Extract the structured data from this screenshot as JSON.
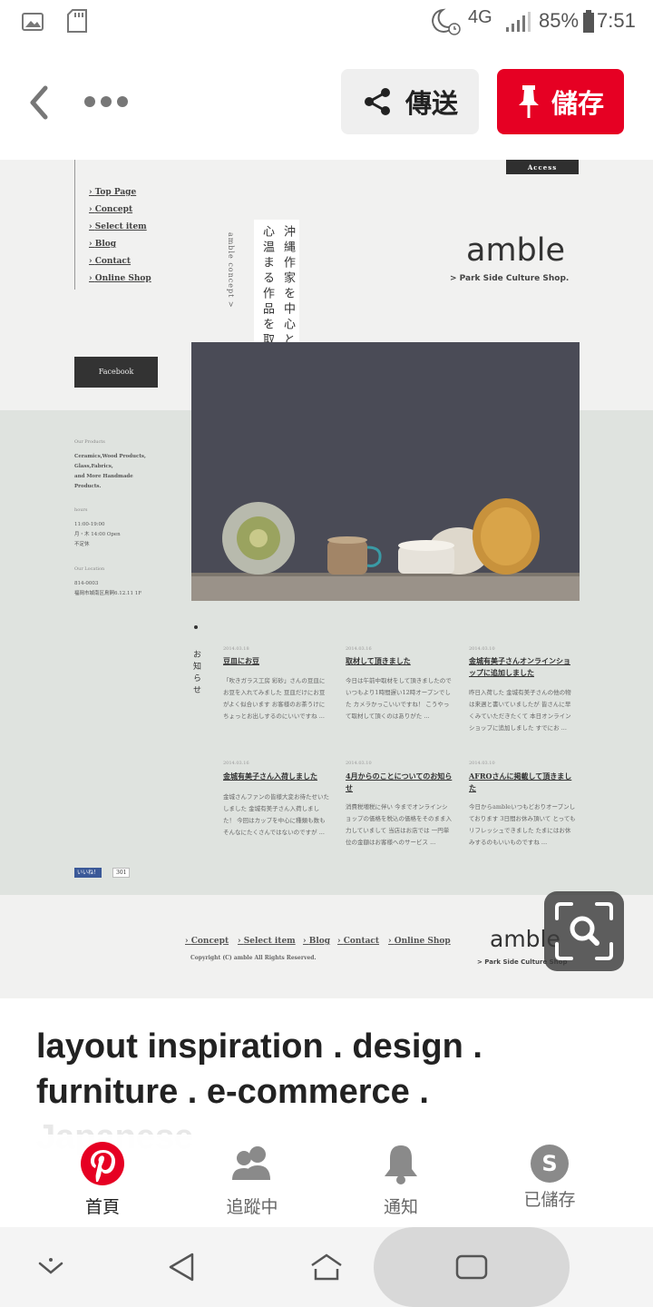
{
  "status_bar": {
    "network": "4G",
    "battery": "85%",
    "time": "7:51"
  },
  "top_bar": {
    "share_label": "傳送",
    "save_label": "儲存"
  },
  "pin_image": {
    "nav_items": [
      "Top Page",
      "Concept",
      "Select item",
      "Blog",
      "Contact",
      "Online Shop"
    ],
    "access_label": "Access",
    "concept_vertical": "amble concept >",
    "tagline_col1": "沖縄作家を中心とした",
    "tagline_col2": "心温まる作品を取扱います",
    "brand": "amble",
    "brand_sub": "> Park Side Culture Shop.",
    "facebook_label": "Facebook",
    "products_heading": "Our Products",
    "products_text": [
      "Ceramics,Wood Products,",
      "Glass,Fabrics,",
      "and More Handmade",
      "Products."
    ],
    "hours_heading": "hours",
    "hours_text": [
      "11:00-19:00",
      "月・木 14:00 Open",
      "不定休"
    ],
    "location_heading": "Our Location",
    "location_text": [
      "814-0003",
      "福岡市城南区鳥飼6.12.11 1F"
    ],
    "news_heading": "お知らせ",
    "news": [
      {
        "date": "2014.03.18",
        "title": "豆皿にお豆",
        "body": "「吹きガラス工房 彩砂」さんの豆皿にお豆を入れてみました 豆皿だけにお豆がよく似合います お客様のお茶うけにちょっとお出しするのにいいですね ..."
      },
      {
        "date": "2014.03.16",
        "title": "取材して頂きました",
        "body": "今日は午前中取材をして頂きましたので いつもより1時間遅い12時オープンでした カメラかっこいいですね！ こうやって取材して頂くのはありがた ..."
      },
      {
        "date": "2014.03.10",
        "title": "金城有美子さんオンラインショップに追加しました",
        "body": "昨日入荷した 金城有美子さんの他の物は来週と書いていましたが 皆さんに早くみていただきたくて 本日オンラインショップに追加しました すでにお ..."
      },
      {
        "date": "2014.03.16",
        "title": "金城有美子さん入荷しました",
        "body": "金城さんファンの皆様大変お待たせいたしました 金城有美子さん入荷しました！ 今回はカップを中心に種類も数もそんなにたくさんではないのですが ..."
      },
      {
        "date": "2014.03.10",
        "title": "4月からのことについてのお知らせ",
        "body": "消費税増税に伴い 今までオンラインショップの価格を税込の価格をそのまま入力していまして 当店はお店では 一円単位の金額はお客様へのサービス ..."
      },
      {
        "date": "2014.03.10",
        "title": "AFROさんに掲載して頂きました",
        "body": "今日からambleいつもどおりオープンしております 3日間お休み頂いて とってもリフレッシュできました たまにはお休みするのもいいものですね ..."
      }
    ],
    "like_label": "いいね！",
    "like_count": "301",
    "footer_nav": [
      "Concept",
      "Select item",
      "Blog",
      "Contact",
      "Online Shop"
    ],
    "copyright": "Copyright (C) amble All Rights Reserved.",
    "footer_brand": "amble",
    "footer_sub": "> Park Side Culture Shop"
  },
  "caption": {
    "line1": "layout inspiration . design .",
    "line2": "furniture . e-commerce .",
    "line3": "Japanese"
  },
  "bottom_nav": {
    "tabs": [
      {
        "label": "首頁"
      },
      {
        "label": "追蹤中"
      },
      {
        "label": "通知"
      },
      {
        "label": "已儲存"
      }
    ],
    "saved_initial": "S"
  },
  "colors": {
    "pinterest_red": "#e60023",
    "pin_bg": "#f1f1f0",
    "pin_band": "#dfe3df"
  }
}
